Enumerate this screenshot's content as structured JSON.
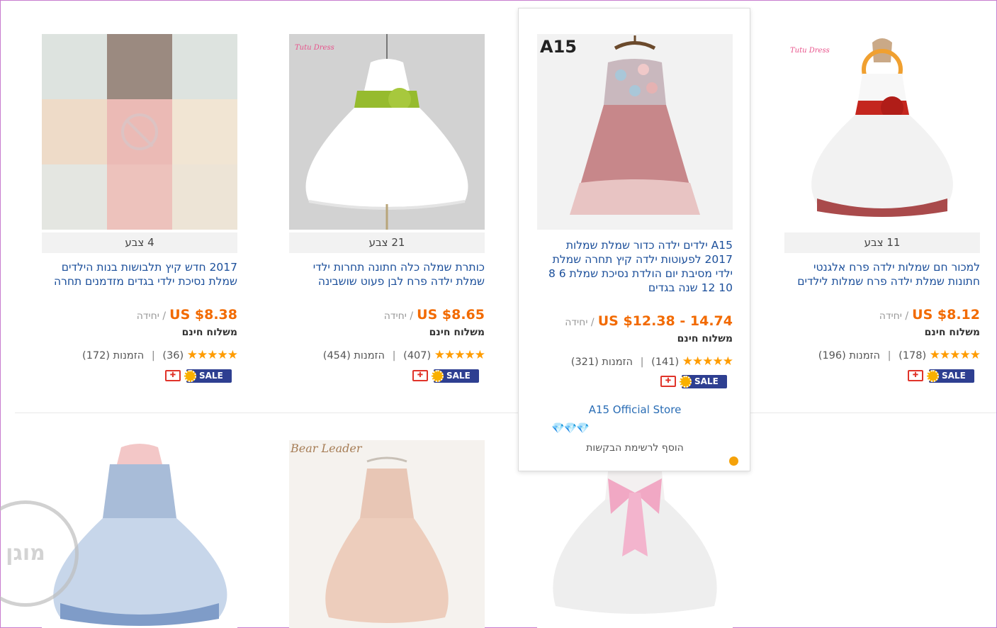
{
  "products": [
    {
      "colors": "4 צבע",
      "title": "2017 חדש קיץ תלבושות בנות הילדים שמלת נסיכת ילדי בגדים מזדמנים תחרה",
      "price": "US $8.38",
      "unit": "/ יחידה",
      "shipping": "משלוח חינם",
      "stars": "★★★★★",
      "reviews": "(36)",
      "orders": "הזמנות (172)",
      "sale_label": "SALE",
      "gift_icon": "gift-card-icon"
    },
    {
      "colors": "21 צבע",
      "title": "כותרת שמלה כלה חתונה תחרות ילדי שמלת ילדה פרח לבן פעוט שושבינה",
      "price": "US $8.65",
      "unit": "/ יחידה",
      "shipping": "משלוח חינם",
      "stars": "★★★★★",
      "reviews": "(407)",
      "orders": "הזמנות (454)",
      "sale_label": "SALE",
      "brand": "Tutu Dress"
    },
    {
      "title": "A15 ילדים ילדה כדור שמלת שמלות 2017 לפעוטות ילדה קיץ תחרה שמלת ילדי מסיבת יום הולדת נסיכת שמלת 6 8 10 12 שנה בגדים",
      "price": "US $12.38 - 14.74",
      "unit": "/ יחידה",
      "shipping": "משלוח חינם",
      "stars": "★★★★★",
      "reviews": "(141)",
      "orders": "הזמנות (321)",
      "sale_label": "SALE",
      "brand": "A15",
      "store": "A15 Official Store",
      "diamonds": "💎💎💎",
      "wishlist": "הוסף לרשימת הבקשות"
    },
    {
      "colors": "11 צבע",
      "title": "למכור חם שמלות ילדה פרח אלגנטי חתונות שמלת ילדה פרח שמלות לילדים",
      "price": "US $8.12",
      "unit": "/ יחידה",
      "shipping": "משלוח חינם",
      "stars": "★★★★★",
      "reviews": "(178)",
      "orders": "הזמנות (196)",
      "sale_label": "SALE",
      "brand": "Tutu Dress"
    },
    {
      "watermark": "מוגן"
    },
    {
      "brand": "Bear Leader"
    },
    {}
  ],
  "colors": {
    "price": "#f26a00",
    "title": "#1a4e9a",
    "stars": "#ff9c00",
    "sale_badge": "#2e3f91"
  }
}
